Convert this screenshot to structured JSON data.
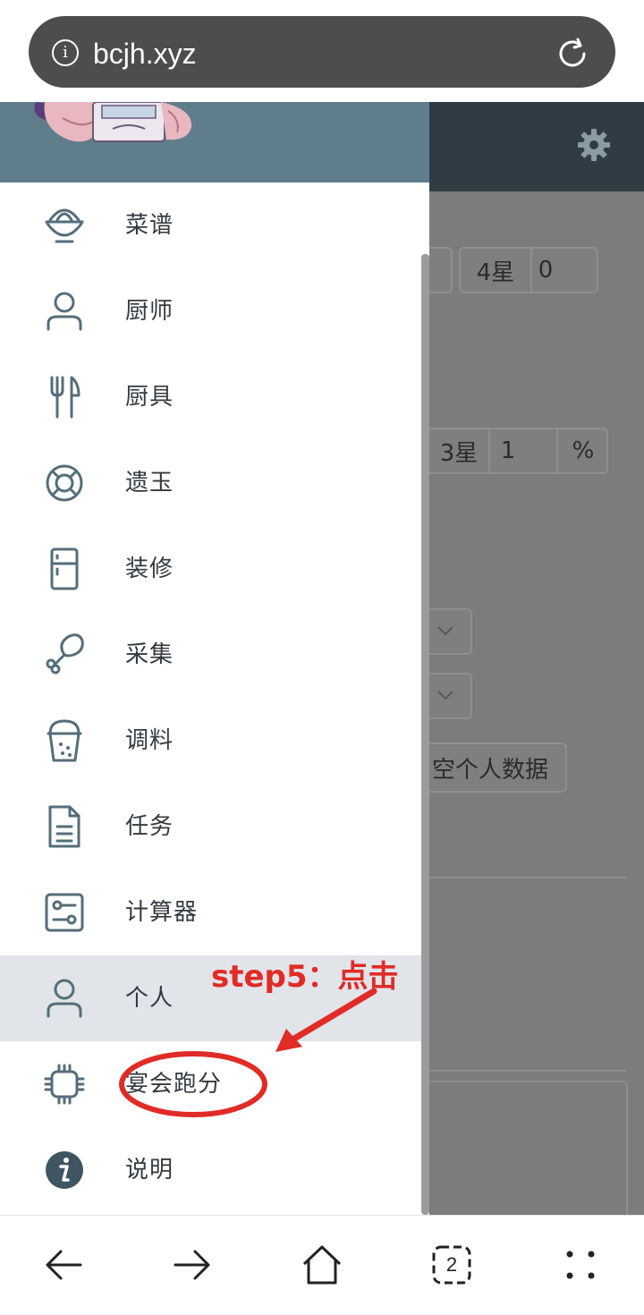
{
  "browser": {
    "url": "bcjh.xyz",
    "info_icon": "info-icon",
    "reload_icon": "reload-icon",
    "tab_count": "2"
  },
  "background_page": {
    "row1": {
      "label": "4星",
      "value": "0"
    },
    "row2": {
      "label": "3星",
      "value": "1",
      "unit": "%"
    },
    "clear_button": "空个人数据"
  },
  "drawer": {
    "items": [
      {
        "label": "菜谱",
        "icon": "bowl-icon"
      },
      {
        "label": "厨师",
        "icon": "person-icon"
      },
      {
        "label": "厨具",
        "icon": "utensils-icon"
      },
      {
        "label": "遗玉",
        "icon": "lifebuoy-icon"
      },
      {
        "label": "装修",
        "icon": "fridge-icon"
      },
      {
        "label": "采集",
        "icon": "drumstick-icon"
      },
      {
        "label": "调料",
        "icon": "cup-icon"
      },
      {
        "label": "任务",
        "icon": "document-icon"
      },
      {
        "label": "计算器",
        "icon": "sliders-icon"
      },
      {
        "label": "个人",
        "icon": "person-icon",
        "active": true
      },
      {
        "label": "宴会跑分",
        "icon": "chip-icon"
      },
      {
        "label": "说明",
        "icon": "info-circle-icon"
      }
    ]
  },
  "annotation": {
    "text": "step5：点击",
    "color": "#e02b26"
  },
  "colors": {
    "drawer_header": "#607d8b",
    "app_bar": "#2f3c44",
    "active_item": "#e1e4e8",
    "icon": "#546e7a"
  }
}
